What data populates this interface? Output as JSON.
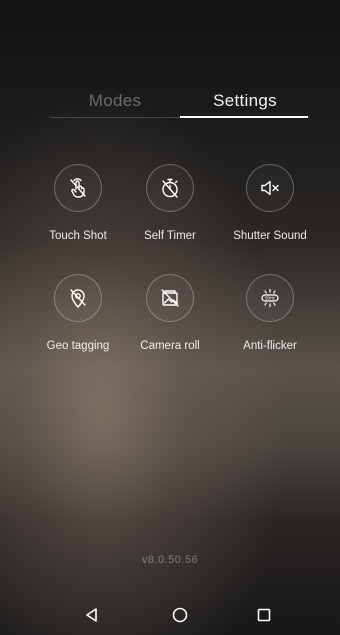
{
  "tabs": [
    {
      "label": "Modes",
      "active": false
    },
    {
      "label": "Settings",
      "active": true
    }
  ],
  "settings": [
    {
      "label": "Touch Shot",
      "icon": "touch-shot-off-icon"
    },
    {
      "label": "Self Timer",
      "icon": "self-timer-off-icon"
    },
    {
      "label": "Shutter Sound",
      "icon": "shutter-sound-muted-icon"
    },
    {
      "label": "Geo tagging",
      "icon": "geo-tagging-off-icon"
    },
    {
      "label": "Camera roll",
      "icon": "camera-roll-off-icon"
    },
    {
      "label": "Anti-flicker",
      "icon": "anti-flicker-icon",
      "icon_text": "50Hz"
    }
  ],
  "version": "v8.0.50.56",
  "navbar": {
    "back_icon": "back-triangle-icon",
    "home_icon": "home-circle-icon",
    "recent_icon": "recent-apps-square-icon"
  }
}
